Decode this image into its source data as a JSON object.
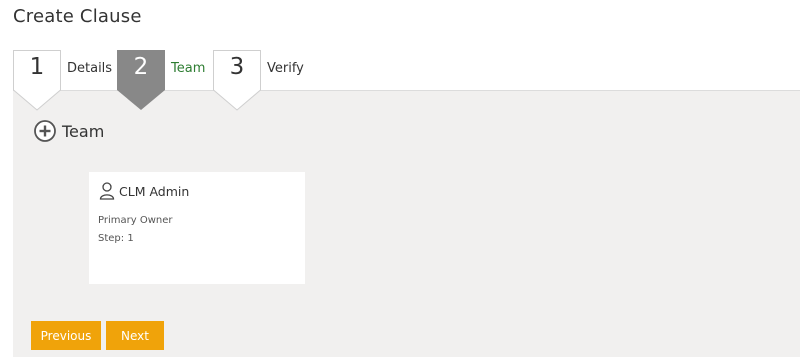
{
  "page": {
    "title": "Create Clause"
  },
  "wizard": {
    "steps": [
      {
        "number": "1",
        "label": "Details",
        "state": "completed"
      },
      {
        "number": "2",
        "label": "Team",
        "state": "active"
      },
      {
        "number": "3",
        "label": "Verify",
        "state": "upcoming"
      }
    ]
  },
  "team_section": {
    "add_label": "Team"
  },
  "team_card": {
    "name": "CLM Admin",
    "role": "Primary Owner",
    "step": "Step: 1",
    "icon": "user-icon"
  },
  "buttons": {
    "previous": "Previous",
    "next": "Next"
  },
  "colors": {
    "active_step": "#888888",
    "active_step_label": "#2e7d32",
    "button": "#f0a30a",
    "panel_background": "#f1f0ef"
  }
}
